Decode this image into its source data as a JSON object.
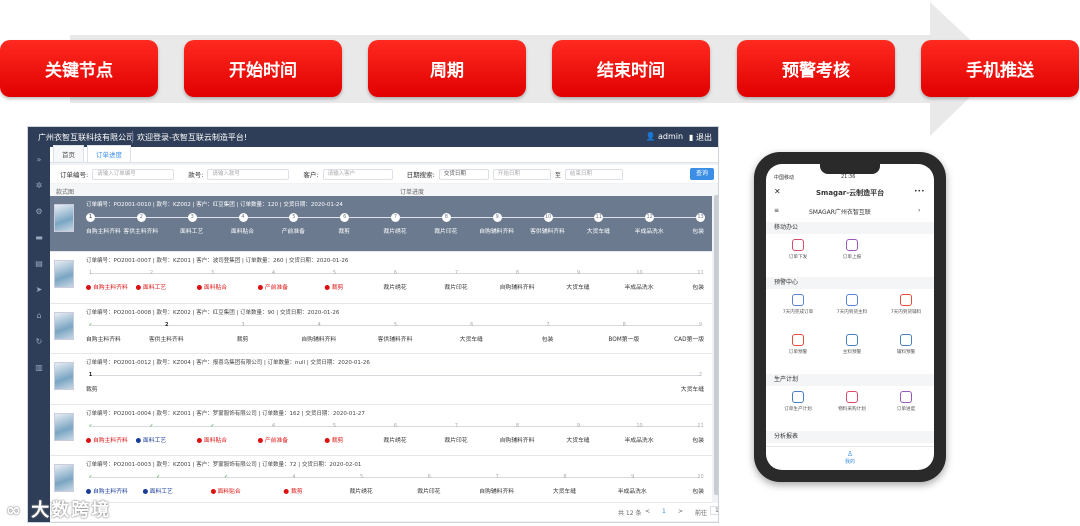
{
  "process": {
    "steps": [
      "关键节点",
      "开始时间",
      "周期",
      "结束时间",
      "预警考核",
      "手机推送"
    ],
    "colors": {
      "pill": "#e00000",
      "band": "#e9e9e9"
    }
  },
  "app": {
    "company": "广州衣智互联科技有限公司",
    "welcome": "欢迎登录-衣智互联云制造平台!",
    "user": "admin",
    "logout": "退出",
    "tabs": [
      "首页",
      "订单进度"
    ],
    "filters": {
      "order_label": "订单编号:",
      "order_placeholder": "请输入订单编号",
      "style_label": "款号:",
      "style_placeholder": "请输入款号",
      "customer_label": "客户:",
      "customer_placeholder": "请输入客户",
      "date_label": "日期搜索:",
      "date_select": "交货日期",
      "start_placeholder": "开始日期",
      "date_sep": "至",
      "end_placeholder": "结束日期",
      "query": "查询"
    },
    "list_header": {
      "image": "款式图",
      "progress": "订单进度"
    },
    "orders": [
      {
        "meta": "订单编号：PO2001-0010 | 款号：KZ002 | 客户：红豆集团 | 订单数量：120 | 交货日期：2020-01-24",
        "steps": [
          {
            "n": "1",
            "label": "自购主料齐料",
            "state": "current"
          },
          {
            "n": "2",
            "label": "客供主料齐料",
            "state": "todo"
          },
          {
            "n": "3",
            "label": "面料工艺",
            "state": "todo"
          },
          {
            "n": "4",
            "label": "面料贴合",
            "state": "todo"
          },
          {
            "n": "5",
            "label": "产前准备",
            "state": "todo"
          },
          {
            "n": "6",
            "label": "裁剪",
            "state": "todo"
          },
          {
            "n": "7",
            "label": "裁片绣花",
            "state": "todo"
          },
          {
            "n": "8",
            "label": "裁片印花",
            "state": "todo"
          },
          {
            "n": "9",
            "label": "自购辅料齐料",
            "state": "todo"
          },
          {
            "n": "10",
            "label": "客供辅料齐料",
            "state": "todo"
          },
          {
            "n": "11",
            "label": "大货车缝",
            "state": "todo"
          },
          {
            "n": "12",
            "label": "半成品洗水",
            "state": "todo"
          },
          {
            "n": "13",
            "label": "包装",
            "state": "todo"
          }
        ]
      },
      {
        "meta": "订单编号：PO2001-0007 | 款号：KZ001 | 客户：波司登集团 | 订单数量：260 | 交货日期：2020-01-26",
        "steps": [
          {
            "n": "1",
            "label": "自购主料齐料",
            "state": "red"
          },
          {
            "n": "2",
            "label": "面料工艺",
            "state": "red"
          },
          {
            "n": "3",
            "label": "面料贴合",
            "state": "red"
          },
          {
            "n": "4",
            "label": "产前准备",
            "state": "red"
          },
          {
            "n": "5",
            "label": "裁剪",
            "state": "red"
          },
          {
            "n": "6",
            "label": "裁片绣花",
            "state": "todo"
          },
          {
            "n": "7",
            "label": "裁片印花",
            "state": "todo"
          },
          {
            "n": "8",
            "label": "自购辅料齐料",
            "state": "todo"
          },
          {
            "n": "9",
            "label": "大货车缝",
            "state": "todo"
          },
          {
            "n": "10",
            "label": "半成品洗水",
            "state": "todo"
          },
          {
            "n": "11",
            "label": "包装",
            "state": "todo"
          }
        ]
      },
      {
        "meta": "订单编号：PO2001-0008 | 款号：KZ002 | 客户：红豆集团 | 订单数量：90 | 交货日期：2020-01-26",
        "steps": [
          {
            "n": "✓",
            "label": "自购主料齐料",
            "state": "done"
          },
          {
            "n": "2",
            "label": "客供主料齐料",
            "state": "current"
          },
          {
            "n": "3",
            "label": "裁剪",
            "state": "todo"
          },
          {
            "n": "4",
            "label": "自购辅料齐料",
            "state": "todo"
          },
          {
            "n": "5",
            "label": "客供辅料齐料",
            "state": "todo"
          },
          {
            "n": "6",
            "label": "大货车缝",
            "state": "todo"
          },
          {
            "n": "7",
            "label": "包装",
            "state": "todo"
          },
          {
            "n": "8",
            "label": "BOM第一版",
            "state": "todo"
          },
          {
            "n": "9",
            "label": "CAD第一版",
            "state": "todo"
          }
        ]
      },
      {
        "meta": "订单编号：PO2001-0012 | 款号：KZ004 | 客户：报喜鸟集团有限公司 | 订单数量：null | 交货日期：2020-01-26",
        "steps": [
          {
            "n": "1",
            "label": "裁剪",
            "state": "current"
          },
          {
            "n": "2",
            "label": "大货车缝",
            "state": "todo"
          }
        ]
      },
      {
        "meta": "订单编号：PO2001-0004 | 款号：KZ001 | 客户：罗蒙服饰有限公司 | 订单数量：162 | 交货日期：2020-01-27",
        "steps": [
          {
            "n": "✓",
            "label": "自购主料齐料",
            "state": "red"
          },
          {
            "n": "✓",
            "label": "面料工艺",
            "state": "blue"
          },
          {
            "n": "✓",
            "label": "面料贴合",
            "state": "red"
          },
          {
            "n": "4",
            "label": "产前准备",
            "state": "red"
          },
          {
            "n": "5",
            "label": "裁剪",
            "state": "red"
          },
          {
            "n": "6",
            "label": "裁片绣花",
            "state": "todo"
          },
          {
            "n": "7",
            "label": "裁片印花",
            "state": "todo"
          },
          {
            "n": "8",
            "label": "自购辅料齐料",
            "state": "todo"
          },
          {
            "n": "9",
            "label": "大货车缝",
            "state": "todo"
          },
          {
            "n": "10",
            "label": "半成品洗水",
            "state": "todo"
          },
          {
            "n": "11",
            "label": "包装",
            "state": "todo"
          }
        ]
      },
      {
        "meta": "订单编号：PO2001-0003 | 款号：KZ001 | 客户：罗蒙服饰有限公司 | 订单数量：72 | 交货日期：2020-02-01",
        "steps": [
          {
            "n": "✓",
            "label": "自购主料齐料",
            "state": "blue"
          },
          {
            "n": "✓",
            "label": "面料工艺",
            "state": "blue"
          },
          {
            "n": "✓",
            "label": "面料贴合",
            "state": "red"
          },
          {
            "n": "4",
            "label": "裁剪",
            "state": "red"
          },
          {
            "n": "5",
            "label": "裁片绣花",
            "state": "todo"
          },
          {
            "n": "6",
            "label": "裁片印花",
            "state": "todo"
          },
          {
            "n": "7",
            "label": "自购辅料齐料",
            "state": "todo"
          },
          {
            "n": "8",
            "label": "大货车缝",
            "state": "todo"
          },
          {
            "n": "9",
            "label": "半成品洗水",
            "state": "todo"
          },
          {
            "n": "10",
            "label": "包装",
            "state": "todo"
          }
        ]
      }
    ],
    "pager": {
      "total": "共 12 条",
      "prev": "<",
      "page": "1",
      "next": ">",
      "goto": "前往",
      "goto_value": "1",
      "page_unit": "页"
    }
  },
  "phone": {
    "carrier": "中国移动",
    "time": "21:36",
    "title": "Smagar-云制造平台",
    "close": "✕",
    "more": "•••",
    "company": "SMAGAR广州衣智互联",
    "sections": [
      {
        "title": "移动办公",
        "items": [
          "订单下发",
          "订单上报"
        ]
      },
      {
        "title": "预警中心",
        "items": [
          "7天内完成订单",
          "7天内到货主料",
          "7天内到货辅料",
          "订单预警",
          "主料预警",
          "辅料预警"
        ]
      },
      {
        "title": "生产计划",
        "items": [
          "订单生产计划",
          "物料采购计划",
          "订单进度"
        ]
      },
      {
        "title": "分析报表",
        "items": []
      }
    ],
    "bottom_tab": "我的"
  }
}
